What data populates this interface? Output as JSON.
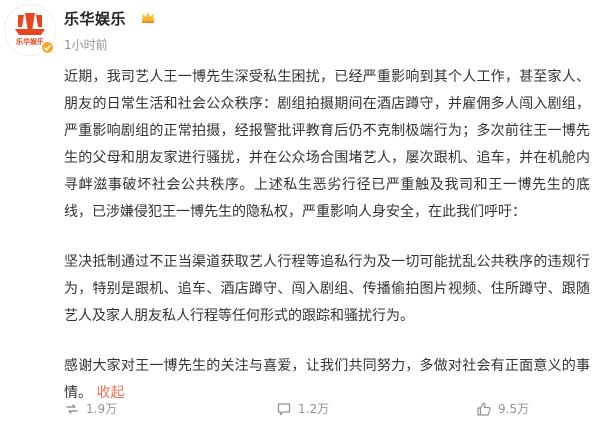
{
  "account": {
    "name": "乐华娱乐",
    "logo_text": "乐华娱乐",
    "time": "1小时前",
    "verified_icon": "verified-badge-icon",
    "crown_icon": "crown-icon",
    "brand_color": "#e8441f"
  },
  "post": {
    "paragraphs": [
      "近期，我司艺人王一博先生深受私生困扰，已经严重影响到其个人工作，甚至家人、朋友的日常生活和社会公众秩序：剧组拍摄期间在酒店蹲守，并雇佣多人闯入剧组，严重影响剧组的正常拍摄，经报警批评教育后仍不克制极端行为；多次前往王一博先生的父母和朋友家进行骚扰，并在公众场合围堵艺人，屡次跟机、追车，并在机舱内寻衅滋事破坏社会公共秩序。上述私生恶劣行径已严重触及我司和王一博先生的底线，已涉嫌侵犯王一博先生的隐私权，严重影响人身安全，在此我们呼吁：",
      "坚决抵制通过不正当渠道获取艺人行程等追私行为及一切可能扰乱公共秩序的违规行为，特别是跟机、追车、酒店蹲守、闯入剧组、传播偷拍图片视频、住所蹲守、跟随艺人及家人朋友私人行程等任何形式的跟踪和骚扰行为。",
      "感谢大家对王一博先生的关注与喜爱，让我们共同努力，多做对社会有正面意义的事情。"
    ],
    "collapse_label": "收起",
    "link_color": "#eb7350"
  },
  "actions": {
    "repost": {
      "icon": "repost-icon",
      "count": "1.9万"
    },
    "comment": {
      "icon": "comment-icon",
      "count": "1.2万"
    },
    "like": {
      "icon": "like-icon",
      "count": "9.5万"
    }
  }
}
